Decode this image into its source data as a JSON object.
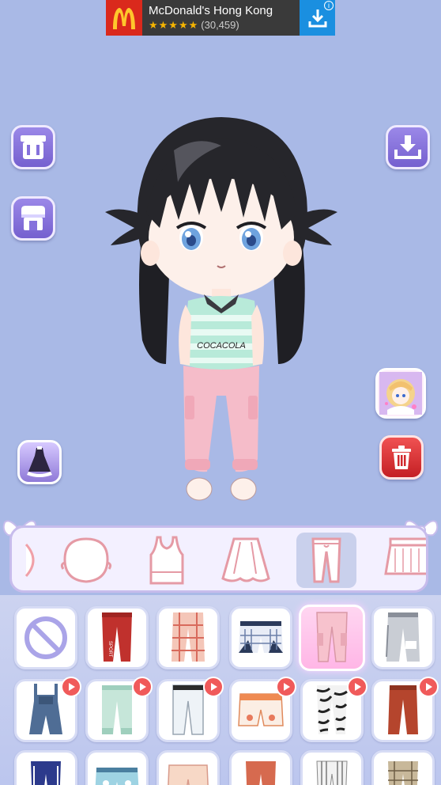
{
  "ad": {
    "title": "McDonald's Hong Kong",
    "stars": "★★★★★",
    "rating_count": "(30,459)",
    "info_icon": "i",
    "colors": {
      "brand": "#da291c",
      "download": "#1a8fe0"
    }
  },
  "left_buttons": [
    {
      "name": "wardrobe-icon"
    },
    {
      "name": "shop-icon"
    },
    {
      "name": "dress-preset-icon"
    }
  ],
  "right_buttons": [
    {
      "name": "download-icon"
    },
    {
      "name": "character-preset-icon"
    },
    {
      "name": "trash-icon"
    }
  ],
  "character": {
    "shirt_text": "COCACOLA"
  },
  "categories": [
    {
      "name": "hair-category-icon"
    },
    {
      "name": "face-category-icon"
    },
    {
      "name": "tank-top-category-icon"
    },
    {
      "name": "cape-category-icon"
    },
    {
      "name": "pants-category-icon",
      "selected": true
    },
    {
      "name": "skirt-category-icon"
    }
  ],
  "items": [
    {
      "name": "none-item",
      "locked": false
    },
    {
      "name": "red-sport-pants",
      "label": "SPORT",
      "locked": false
    },
    {
      "name": "plaid-pants",
      "locked": false
    },
    {
      "name": "plaid-shorts",
      "locked": false
    },
    {
      "name": "pink-cargo-pants",
      "locked": false,
      "selected": true
    },
    {
      "name": "gray-cargo-pants",
      "locked": false
    },
    {
      "name": "denim-overalls",
      "locked": true
    },
    {
      "name": "mint-jogger-pants",
      "locked": true
    },
    {
      "name": "white-jeans",
      "locked": true
    },
    {
      "name": "orange-belt-shorts",
      "locked": true
    },
    {
      "name": "zebra-pants",
      "locked": true
    },
    {
      "name": "rust-pants",
      "locked": true
    },
    {
      "name": "navy-track-pants",
      "locked": false
    },
    {
      "name": "patterned-shorts",
      "locked": false
    },
    {
      "name": "peach-pants",
      "locked": false
    },
    {
      "name": "salmon-pants",
      "locked": false
    },
    {
      "name": "striped-pants",
      "locked": false
    },
    {
      "name": "checkered-pants",
      "locked": false
    }
  ]
}
